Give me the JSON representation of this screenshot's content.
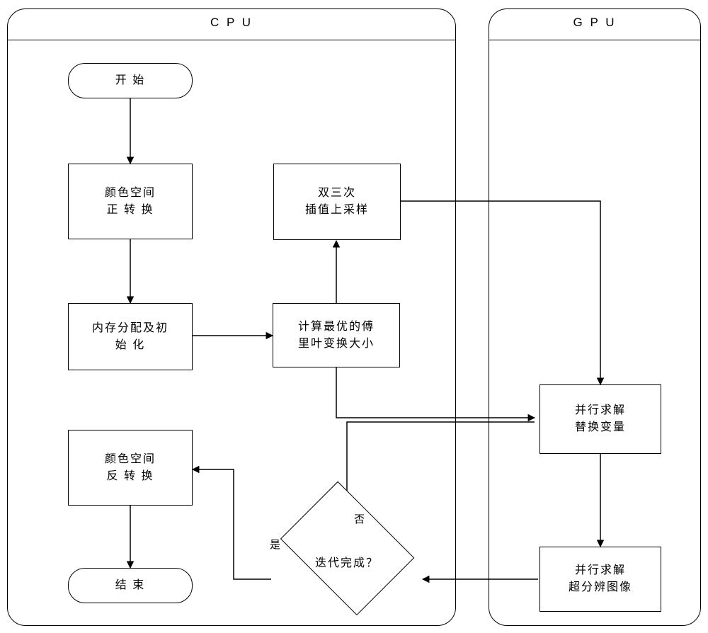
{
  "diagram": {
    "type": "flowchart",
    "lanes": [
      {
        "id": "cpu",
        "title": "C P U"
      },
      {
        "id": "gpu",
        "title": "G P U"
      }
    ],
    "nodes": {
      "start": {
        "lines": [
          "开 始"
        ],
        "shape": "terminator"
      },
      "color_forward": {
        "lines": [
          "颜色空间",
          "正 转 换"
        ],
        "shape": "process"
      },
      "mem_alloc": {
        "lines": [
          "内存分配及初",
          "始 化"
        ],
        "shape": "process"
      },
      "fft_size": {
        "lines": [
          "计算最优的傅",
          "里叶变换大小"
        ],
        "shape": "process"
      },
      "bicubic": {
        "lines": [
          "双三次",
          "插值上采样"
        ],
        "shape": "process"
      },
      "parallel_var": {
        "lines": [
          "并行求解",
          "替换变量"
        ],
        "shape": "process"
      },
      "parallel_sr": {
        "lines": [
          "并行求解",
          "超分辨图像"
        ],
        "shape": "process"
      },
      "decision": {
        "lines": [
          "迭代完成？"
        ],
        "shape": "decision"
      },
      "color_inverse": {
        "lines": [
          "颜色空间",
          "反 转 换"
        ],
        "shape": "process"
      },
      "end": {
        "lines": [
          "结 束"
        ],
        "shape": "terminator"
      }
    },
    "edge_labels": {
      "no": "否",
      "yes": "是"
    }
  }
}
